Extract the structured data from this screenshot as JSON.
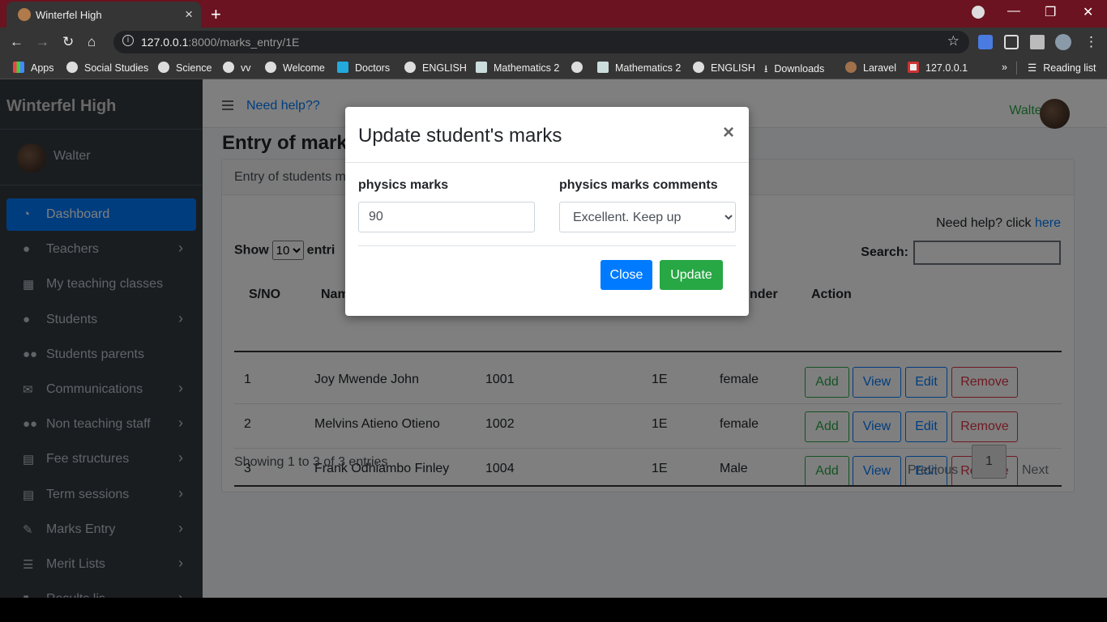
{
  "browser": {
    "tab_title": "Winterfel High",
    "tab_close": "×",
    "new_tab": "+",
    "url_host": "127.0.0.1",
    "url_rest": ":8000/marks_entry/1E",
    "info_icon": "i",
    "star_icon": "☆",
    "minimize": "—",
    "restore": "❐",
    "close": "✕",
    "bookmarks": [
      "Apps",
      "Social Studies",
      "Science",
      "vv",
      "Welcome",
      "Doctors",
      "ENGLISH",
      "Mathematics 2",
      "",
      "Mathematics 2",
      "ENGLISH",
      "Downloads",
      "Laravel",
      "127.0.0.1"
    ],
    "more": "»",
    "reading_list": "Reading list"
  },
  "sidebar": {
    "brand": "Winterfel High",
    "user": "Walter",
    "items": [
      {
        "label": "Dashboard",
        "icon": "tachometer-icon"
      },
      {
        "label": "Teachers",
        "icon": "user-icon"
      },
      {
        "label": "My teaching classes",
        "icon": "grid-icon"
      },
      {
        "label": "Students",
        "icon": "user-icon"
      },
      {
        "label": "Students parents",
        "icon": "users-icon"
      },
      {
        "label": "Communications",
        "icon": "envelope-icon"
      },
      {
        "label": "Non teaching staff",
        "icon": "users-icon"
      },
      {
        "label": "Fee structures",
        "icon": "table-icon"
      },
      {
        "label": "Term sessions",
        "icon": "table-icon"
      },
      {
        "label": "Marks Entry",
        "icon": "edit-icon"
      },
      {
        "label": "Merit Lists",
        "icon": "list-icon"
      },
      {
        "label": "Results lis",
        "icon": "file-icon"
      }
    ],
    "chevron": "›"
  },
  "topnav": {
    "help": "Need help??",
    "user": "Walter"
  },
  "page": {
    "title": "Entry of marks",
    "card_header": "Entry of students m",
    "need_help": "Need help? click ",
    "need_help_link": "here",
    "show_label": "Show",
    "show_value": "10",
    "entries_label": "entri",
    "search_label": "Search:",
    "columns": [
      "S/NO",
      "Nam",
      "nder",
      "Action"
    ],
    "rows": [
      {
        "sno": "1",
        "name": "Joy Mwende John",
        "adm": "1001",
        "cls": "1E",
        "gender": "female"
      },
      {
        "sno": "2",
        "name": "Melvins Atieno Otieno",
        "adm": "1002",
        "cls": "1E",
        "gender": "female"
      },
      {
        "sno": "3",
        "name": "Frank Odhiambo Finley",
        "adm": "1004",
        "cls": "1E",
        "gender": "Male"
      }
    ],
    "actions": {
      "add": "Add",
      "view": "View",
      "edit": "Edit",
      "remove": "Remove"
    },
    "info": "Showing 1 to 3 of 3 entries",
    "prev": "Previous",
    "page": "1",
    "next": "Next"
  },
  "modal": {
    "title": "Update student's marks",
    "close_x": "×",
    "marks_label": "physics marks",
    "marks_value": "90",
    "comments_label": "physics marks comments",
    "comments_value": "Excellent. Keep up",
    "close_btn": "Close",
    "update_btn": "Update"
  },
  "colors": {
    "primary": "#007bff",
    "success": "#28a745",
    "danger": "#dc3545",
    "sidebar": "#343a40",
    "tabbar": "#6b1320"
  }
}
